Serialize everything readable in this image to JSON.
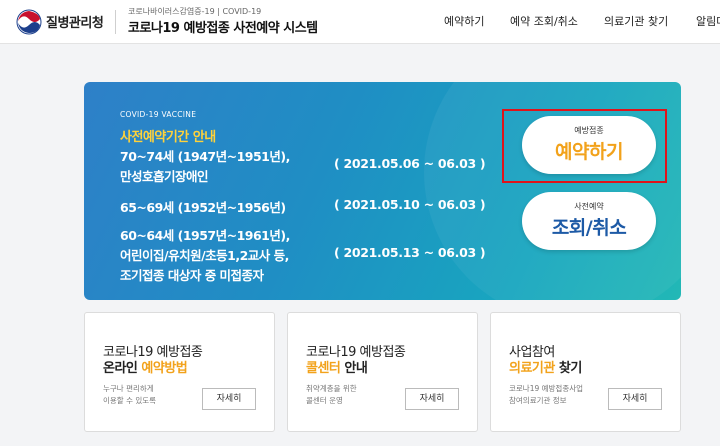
{
  "header": {
    "org_name": "질병관리청",
    "subtitle": "코로나바이러스감염증-19 | COVID-19",
    "system_title": "코로나19 예방접종 사전예약 시스템",
    "nav": [
      "예약하기",
      "예약 조회/취소",
      "의료기관 찾기",
      "알림마당"
    ]
  },
  "banner": {
    "eyebrow": "COVID-19 VACCINE",
    "heading": "사전예약기간 안내",
    "line1": "70~74세 (1947년~1951년),",
    "line2": "만성호흡기장애인",
    "date1": "( 2021.05.06 ~ 06.03 )",
    "line3": "65~69세 (1952년~1956년)",
    "date2": "( 2021.05.10 ~ 06.03 )",
    "line4": "60~64세 (1957년~1961년),",
    "line5": "어린이집/유치원/초등1,2교사 등,",
    "date3": "( 2021.05.13 ~ 06.03 )",
    "line6": "조기접종 대상자 중 미접종자"
  },
  "actions": {
    "reserve_small": "예방접종",
    "reserve_big": "예약하기",
    "lookup_small": "사전예약",
    "lookup_big": "조회/취소"
  },
  "cards": [
    {
      "l1": "코로나19 예방접종",
      "l2a": "온라인 ",
      "l2b": "예약방법",
      "l2c": "",
      "d1": "누구나 편리하게",
      "d2": "이용할 수 있도록",
      "btn": "자세히"
    },
    {
      "l1": "코로나19 예방접종",
      "l2a": "",
      "l2b": "콜센터",
      "l2c": " 안내",
      "d1": "취약계층을 위한",
      "d2": "콜센터 운영",
      "btn": "자세히"
    },
    {
      "l1": "사업참여",
      "l2a": "",
      "l2b": "의료기관",
      "l2c": " 찾기",
      "d1": "코로나19 예방접종사업",
      "d2": "참여의료기관 정보",
      "btn": "자세히"
    }
  ],
  "colors": {
    "accent_yellow": "#f2a21b",
    "brand_blue": "#1d5aa6",
    "highlight_red": "#e0131a"
  }
}
